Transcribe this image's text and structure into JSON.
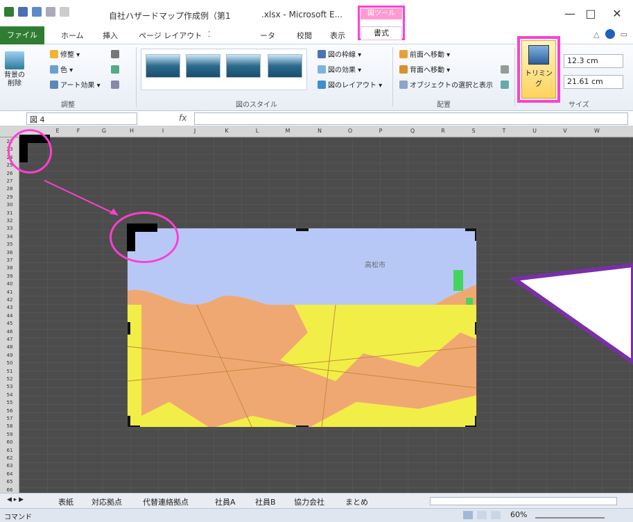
{
  "window": {
    "title_part1": "自社ハザードマップ作成例（第1",
    "title_part2": ".xlsx - Microsoft E...",
    "context_tab_group": "図ツール",
    "min": "—",
    "max": "□",
    "close": "✕"
  },
  "tabs": {
    "file": "ファイル",
    "items": [
      "ホーム",
      "挿入",
      "ページ レイアウト",
      "⁚",
      "ータ",
      "校閲",
      "表示"
    ],
    "format": "書式"
  },
  "ribbon": {
    "adjust": {
      "remove_bg": "背景の\n削除",
      "corrections": "修整 ▾",
      "color": "色 ▾",
      "art_effects": "アート効果 ▾",
      "label": "調整"
    },
    "styles": {
      "border": "図の枠線 ▾",
      "effects": "図の効果 ▾",
      "layout": "図のレイアウト ▾",
      "label": "図のスタイル"
    },
    "arrange": {
      "bring_forward": "前面へ移動 ▾",
      "send_backward": "背面へ移動 ▾",
      "selection_pane": "オブジェクトの選択と表示",
      "label": "配置"
    },
    "size": {
      "crop": "トリミング",
      "height": "12.3 cm",
      "width": "21.61 cm",
      "label": "サイズ"
    }
  },
  "formula_bar": {
    "name_box": "図 4",
    "fx": "fx"
  },
  "columns": [
    "E",
    "F",
    "G",
    "H",
    "I",
    "J",
    "K",
    "L",
    "M",
    "N",
    "O",
    "P",
    "Q",
    "R",
    "S",
    "T",
    "U",
    "V",
    "W"
  ],
  "rows": [
    "22",
    "23",
    "24",
    "25",
    "26",
    "27",
    "28",
    "29",
    "30",
    "31",
    "32",
    "33",
    "34",
    "35",
    "36",
    "37",
    "38",
    "39",
    "40",
    "41",
    "42",
    "43",
    "44",
    "45",
    "46",
    "47",
    "48",
    "49",
    "50",
    "51",
    "52",
    "53",
    "54",
    "55",
    "56",
    "57",
    "58",
    "59",
    "60",
    "61",
    "62",
    "63",
    "64",
    "65",
    "66"
  ],
  "map": {
    "place_label": "高松市"
  },
  "sheet_tabs": [
    "表紙",
    "対応拠点",
    "代替連絡拠点",
    "社員A",
    "社員B",
    "協力会社",
    "まとめ"
  ],
  "status": {
    "mode": "コマンド",
    "zoom": "60%"
  },
  "colors": {
    "highlight": "#ff3fd1",
    "arrow": "#7a2fa8",
    "file_tab": "#2f7d32"
  }
}
